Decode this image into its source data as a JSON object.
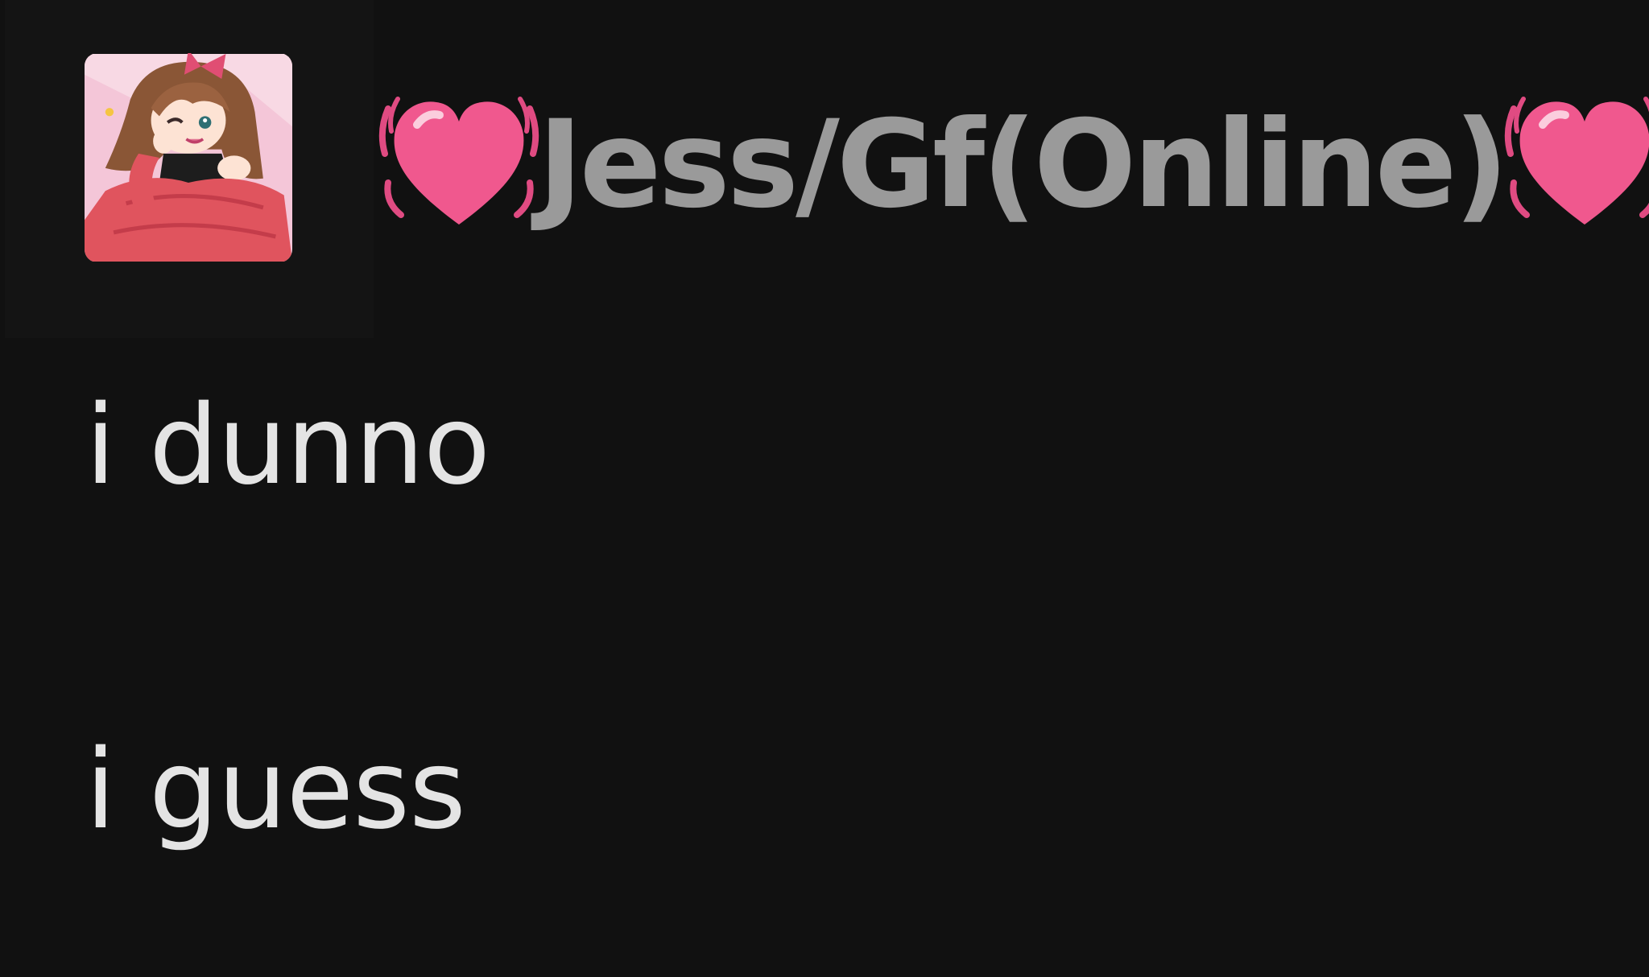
{
  "message_group": {
    "author": {
      "display_name": "Jess/Gf(Online)",
      "avatar_icon": "avatar-anime-girl-icon",
      "name_color": "#9a9a9a",
      "decoration_icon": "beating-heart-icon"
    },
    "messages": [
      {
        "text": "i dunno"
      },
      {
        "text": "i guess"
      }
    ]
  },
  "colors": {
    "background": "#111111",
    "message_text": "#e4e4e4",
    "heart_pink": "#f0588e"
  }
}
